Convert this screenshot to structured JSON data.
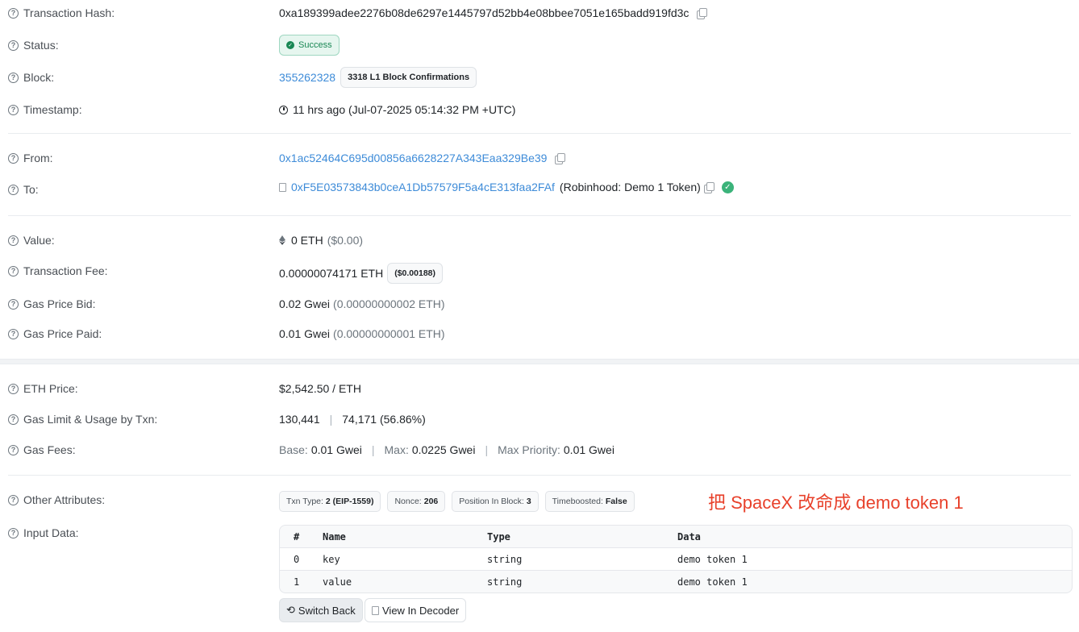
{
  "transaction_hash": {
    "label": "Transaction Hash:",
    "value": "0xa189399adee2276b08de6297e1445797d52bb4e08bbee7051e165badd919fd3c"
  },
  "status": {
    "label": "Status:",
    "value": "Success"
  },
  "block": {
    "label": "Block:",
    "number": "355262328",
    "confirmations": "3318 L1 Block Confirmations"
  },
  "timestamp": {
    "label": "Timestamp:",
    "value": "11 hrs ago (Jul-07-2025 05:14:32 PM +UTC)"
  },
  "from": {
    "label": "From:",
    "address": "0x1ac52464C695d00856a6628227A343Eaa329Be39"
  },
  "to": {
    "label": "To:",
    "address": "0xF5E03573843b0ceA1Db57579F5a4cE313faa2FAf",
    "name": "(Robinhood: Demo 1 Token)"
  },
  "value": {
    "label": "Value:",
    "amount": "0 ETH",
    "usd": "($0.00)"
  },
  "transaction_fee": {
    "label": "Transaction Fee:",
    "amount": "0.00000074171 ETH",
    "usd": "($0.00188)"
  },
  "gas_price_bid": {
    "label": "Gas Price Bid:",
    "gwei": "0.02 Gwei",
    "eth": "(0.00000000002 ETH)"
  },
  "gas_price_paid": {
    "label": "Gas Price Paid:",
    "gwei": "0.01 Gwei",
    "eth": "(0.00000000001 ETH)"
  },
  "eth_price": {
    "label": "ETH Price:",
    "value": "$2,542.50 / ETH"
  },
  "gas_limit": {
    "label": "Gas Limit & Usage by Txn:",
    "limit": "130,441",
    "separator": "|",
    "usage": "74,171 (56.86%)"
  },
  "gas_fees": {
    "label": "Gas Fees:",
    "base_label": "Base:",
    "base_value": "0.01 Gwei",
    "max_label": "Max:",
    "max_value": "0.0225 Gwei",
    "priority_label": "Max Priority:",
    "priority_value": "0.01 Gwei",
    "separator": "|"
  },
  "other_attributes": {
    "label": "Other Attributes:",
    "chips": [
      {
        "key": "Txn Type:",
        "value": "2 (EIP-1559)"
      },
      {
        "key": "Nonce:",
        "value": "206"
      },
      {
        "key": "Position In Block:",
        "value": "3"
      },
      {
        "key": "Timeboosted:",
        "value": "False"
      }
    ]
  },
  "annotation": "把 SpaceX 改命成 demo token 1",
  "input_data": {
    "label": "Input Data:",
    "columns": [
      "#",
      "Name",
      "Type",
      "Data"
    ],
    "rows": [
      [
        "0",
        "key",
        "string",
        "demo token 1"
      ],
      [
        "1",
        "value",
        "string",
        "demo token 1"
      ]
    ],
    "switch_back": "Switch Back",
    "view_decoder": "View In Decoder"
  },
  "colors": {
    "link": "#3d8bd8",
    "success": "#198754",
    "annotation": "#e8412b"
  }
}
